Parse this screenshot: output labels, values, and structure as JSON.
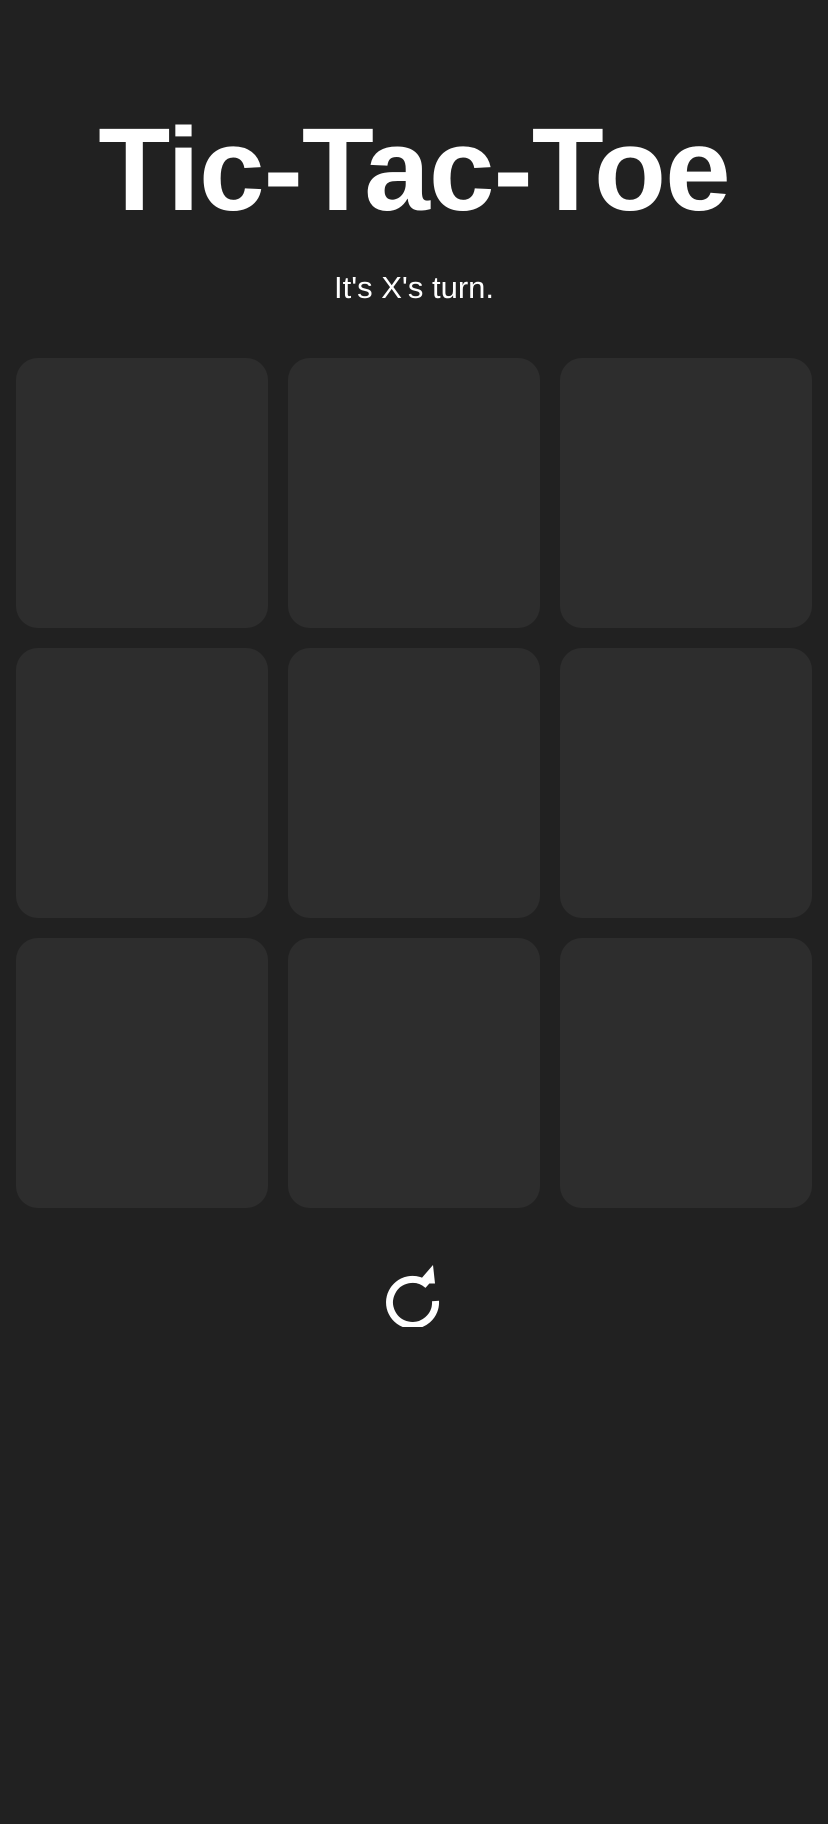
{
  "title": "Tic-Tac-Toe",
  "status": "It's X's turn.",
  "board": {
    "cells": [
      "",
      "",
      "",
      "",
      "",
      "",
      "",
      "",
      ""
    ]
  },
  "reset": {
    "icon": "restart-icon"
  },
  "colors": {
    "background": "#212121",
    "cell": "#2d2d2d",
    "text": "#ffffff"
  }
}
